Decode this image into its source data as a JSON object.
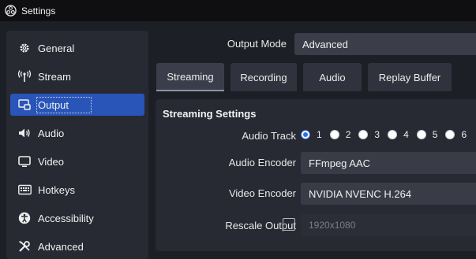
{
  "window": {
    "title": "Settings"
  },
  "sidebar": {
    "items": [
      {
        "label": "General",
        "icon": "gear-icon"
      },
      {
        "label": "Stream",
        "icon": "antenna-icon"
      },
      {
        "label": "Output",
        "icon": "output-icon",
        "active": true
      },
      {
        "label": "Audio",
        "icon": "speaker-icon"
      },
      {
        "label": "Video",
        "icon": "monitor-icon"
      },
      {
        "label": "Hotkeys",
        "icon": "keyboard-icon"
      },
      {
        "label": "Accessibility",
        "icon": "accessibility-icon"
      },
      {
        "label": "Advanced",
        "icon": "tools-icon"
      }
    ]
  },
  "output_mode": {
    "label": "Output Mode",
    "value": "Advanced"
  },
  "tabs": [
    {
      "label": "Streaming",
      "active": true
    },
    {
      "label": "Recording"
    },
    {
      "label": "Audio"
    },
    {
      "label": "Replay Buffer"
    }
  ],
  "streaming": {
    "title": "Streaming Settings",
    "audio_track": {
      "label": "Audio Track",
      "options": [
        "1",
        "2",
        "3",
        "4",
        "5",
        "6"
      ],
      "selected": "1"
    },
    "audio_encoder": {
      "label": "Audio Encoder",
      "value": "FFmpeg AAC"
    },
    "video_encoder": {
      "label": "Video Encoder",
      "value": "NVIDIA NVENC H.264"
    },
    "rescale_output": {
      "label": "Rescale Output",
      "checked": false,
      "value": "1920x1080"
    }
  },
  "colors": {
    "accent": "#2a55b8",
    "background": "#1d1f26",
    "panel": "#272a33"
  }
}
